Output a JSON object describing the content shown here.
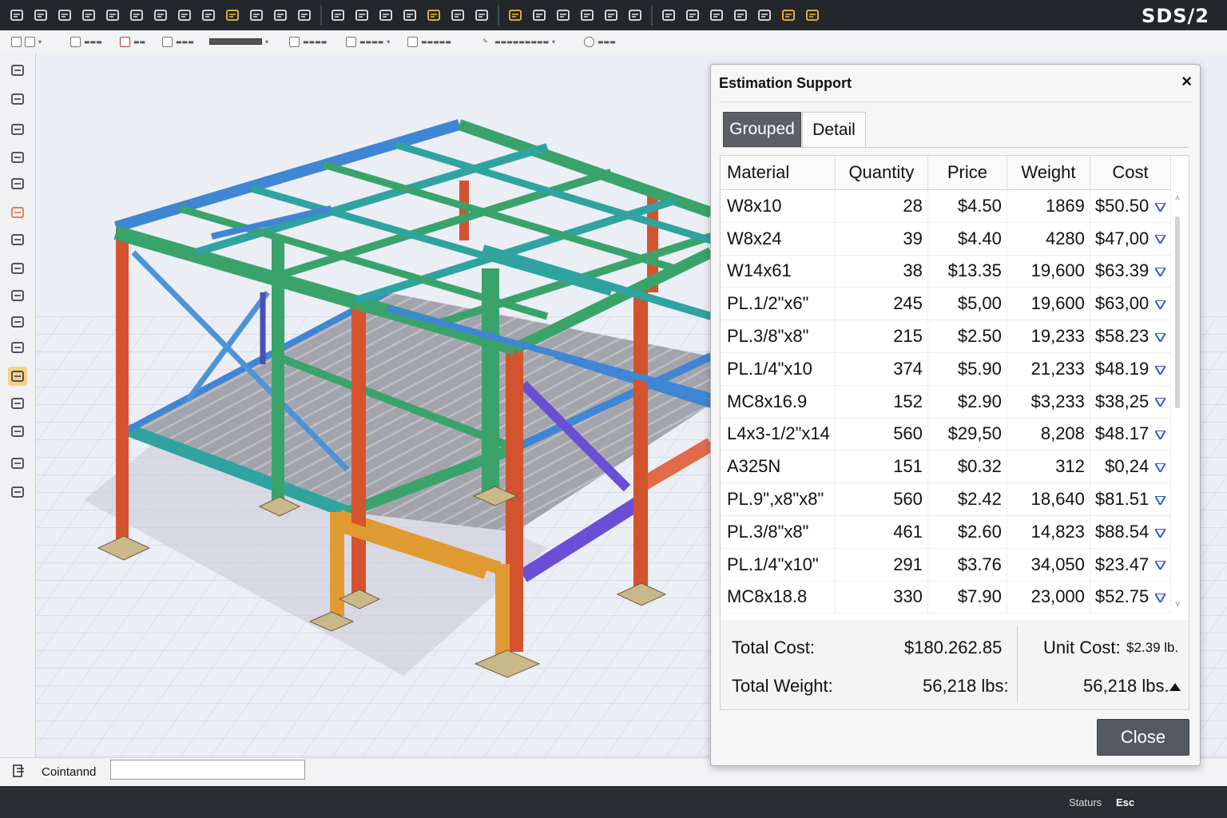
{
  "app": {
    "brand": "SDS/2"
  },
  "toolbar": {
    "top_icons": [
      "select-icon",
      "back-icon",
      "folder-icon",
      "save-icon",
      "monitor-icon",
      "window-icon",
      "search-icon",
      "gears-icon",
      "panel-icon",
      "shield-icon",
      "layout-icon",
      "wand-icon",
      "network-icon",
      "grid-icon",
      "book-icon",
      "print-icon",
      "document-icon",
      "pin-icon",
      "chart-icon",
      "stack-icon",
      "bulb-icon",
      "list-icon",
      "list-icon",
      "list-icon",
      "calculator-icon",
      "calendar-icon",
      "brush-icon",
      "ruler-icon",
      "cut-icon",
      "link-icon",
      "curve-icon",
      "pencil-icon",
      "tools-icon"
    ]
  },
  "left_tools": [
    "layers-icon",
    "zoom-icon",
    "view-icon",
    "triangle-icon",
    "frame-icon",
    "shape-icon",
    "circle-icon",
    "arrow-icon",
    "rotate-icon",
    "grid-icon",
    "copy-icon",
    "draw-icon",
    "lasso-icon",
    "move-icon",
    "edit-icon",
    "shield-icon"
  ],
  "command": {
    "label": "Cointannd",
    "input_value": ""
  },
  "status": {
    "label": "Staturs",
    "escape": "Esc"
  },
  "dialog": {
    "title": "Estimation Support",
    "close_x": "×",
    "tabs": [
      {
        "label": "Grouped",
        "active": true
      },
      {
        "label": "Detail",
        "active": false
      }
    ],
    "columns": [
      "Material",
      "Quantity",
      "Price",
      "Weight",
      "Cost"
    ],
    "rows": [
      {
        "material": "W8x10",
        "quantity": "28",
        "price": "$4.50",
        "weight": "1869",
        "cost": "$50.50"
      },
      {
        "material": "W8x24",
        "quantity": "39",
        "price": "$4.40",
        "weight": "4280",
        "cost": "$47,00"
      },
      {
        "material": "W14x61",
        "quantity": "38",
        "price": "$13.35",
        "weight": "19,600",
        "cost": "$63.39"
      },
      {
        "material": "PL.1/2\"x6\"",
        "quantity": "245",
        "price": "$5,00",
        "weight": "19,600",
        "cost": "$63,00"
      },
      {
        "material": "PL.3/8\"x8\"",
        "quantity": "215",
        "price": "$2.50",
        "weight": "19,233",
        "cost": "$58.23"
      },
      {
        "material": "PL.1/4\"x10",
        "quantity": "374",
        "price": "$5.90",
        "weight": "21,233",
        "cost": "$48.19"
      },
      {
        "material": "MC8x16.9",
        "quantity": "152",
        "price": "$2.90",
        "weight": "$3,233",
        "cost": "$38,25"
      },
      {
        "material": "L4x3-1/2\"x14",
        "quantity": "560",
        "price": "$29,50",
        "weight": "8,208",
        "cost": "$48.17"
      },
      {
        "material": "A325N",
        "quantity": "151",
        "price": "$0.32",
        "weight": "312",
        "cost": "$0,24"
      },
      {
        "material": "PL.9\",x8\"x8\"",
        "quantity": "560",
        "price": "$2.42",
        "weight": "18,640",
        "cost": "$81.51"
      },
      {
        "material": "PL.3/8\"x8\"",
        "quantity": "461",
        "price": "$2.60",
        "weight": "14,823",
        "cost": "$88.54"
      },
      {
        "material": "PL.1/4\"x10\"",
        "quantity": "291",
        "price": "$3.76",
        "weight": "34,050",
        "cost": "$23.47"
      },
      {
        "material": "MC8x18.8",
        "quantity": "330",
        "price": "$7.90",
        "weight": "23,000",
        "cost": "$52.75"
      }
    ],
    "summary": {
      "total_cost_label": "Total Cost:",
      "total_cost_value": "$180.262.85",
      "unit_cost_label": "Unit Cost:",
      "unit_cost_value": "$2.39 lb.",
      "total_weight_label": "Total Weight:",
      "total_weight_value": "56,218 lbs:",
      "total_weight_value_2": "56,218 lbs."
    },
    "close_button": "Close"
  },
  "colors": {
    "column": "#d4532f",
    "green_beam": "#3aa36b",
    "teal_beam": "#2fa3a0",
    "blue_beam": "#3f86d4",
    "orange_frame": "#e09a32",
    "purple_brace": "#6a4fd6",
    "filter_arrow": "#2d5bd6"
  }
}
